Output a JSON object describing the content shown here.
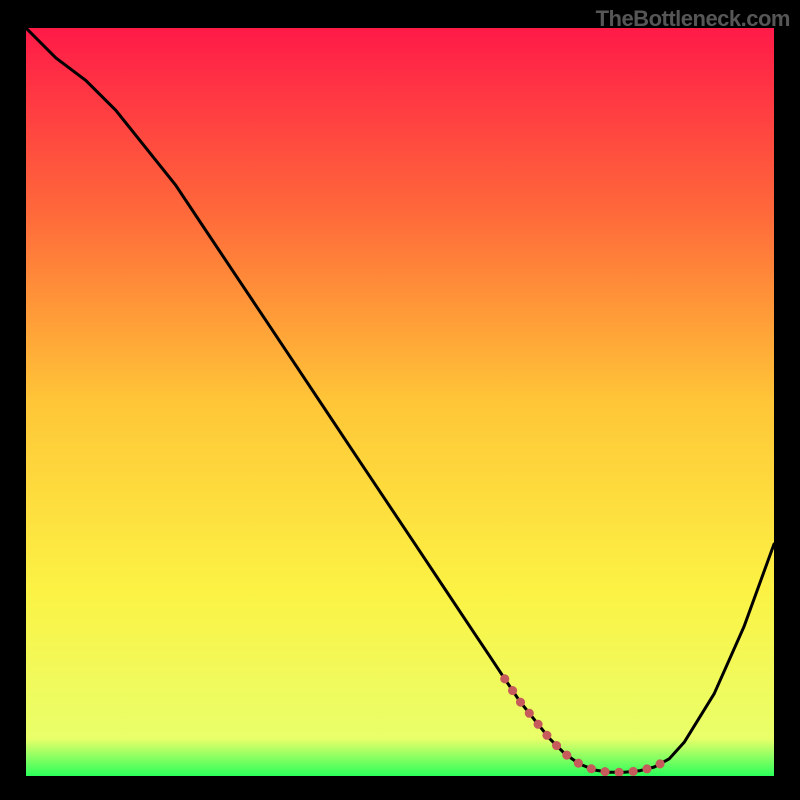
{
  "watermark": "TheBottleneck.com",
  "colors": {
    "gradient_stops": [
      {
        "offset": "0%",
        "color": "#ff1a48"
      },
      {
        "offset": "25%",
        "color": "#ff6a3a"
      },
      {
        "offset": "50%",
        "color": "#ffc637"
      },
      {
        "offset": "75%",
        "color": "#fcf244"
      },
      {
        "offset": "95%",
        "color": "#e9ff6a"
      },
      {
        "offset": "100%",
        "color": "#2bff5a"
      }
    ],
    "curve_stroke": "#000000",
    "marker_stroke": "#c75a5a"
  },
  "chart_data": {
    "type": "line",
    "title": "",
    "xlabel": "",
    "ylabel": "",
    "xlim": [
      0,
      100
    ],
    "ylim": [
      0,
      100
    ],
    "series": [
      {
        "name": "curve",
        "x": [
          0,
          4,
          8,
          12,
          16,
          20,
          24,
          28,
          32,
          36,
          40,
          44,
          48,
          52,
          56,
          60,
          62,
          64,
          66,
          68,
          70,
          72,
          74,
          76,
          78,
          80,
          82,
          84,
          86,
          88,
          92,
          96,
          100
        ],
        "y": [
          100,
          96,
          93,
          89,
          84,
          79,
          73,
          67,
          61,
          55,
          49,
          43,
          37,
          31,
          25,
          19,
          16,
          13,
          10,
          7.5,
          5,
          3,
          1.6,
          0.8,
          0.5,
          0.5,
          0.7,
          1.2,
          2.3,
          4.5,
          11,
          20,
          31
        ]
      },
      {
        "name": "markers",
        "x": [
          64,
          66,
          68,
          70,
          72,
          74,
          76,
          78,
          80,
          82,
          84,
          86
        ],
        "y": [
          13,
          10,
          7.5,
          5,
          3,
          1.6,
          0.8,
          0.5,
          0.5,
          0.7,
          1.2,
          2.3
        ]
      }
    ]
  }
}
